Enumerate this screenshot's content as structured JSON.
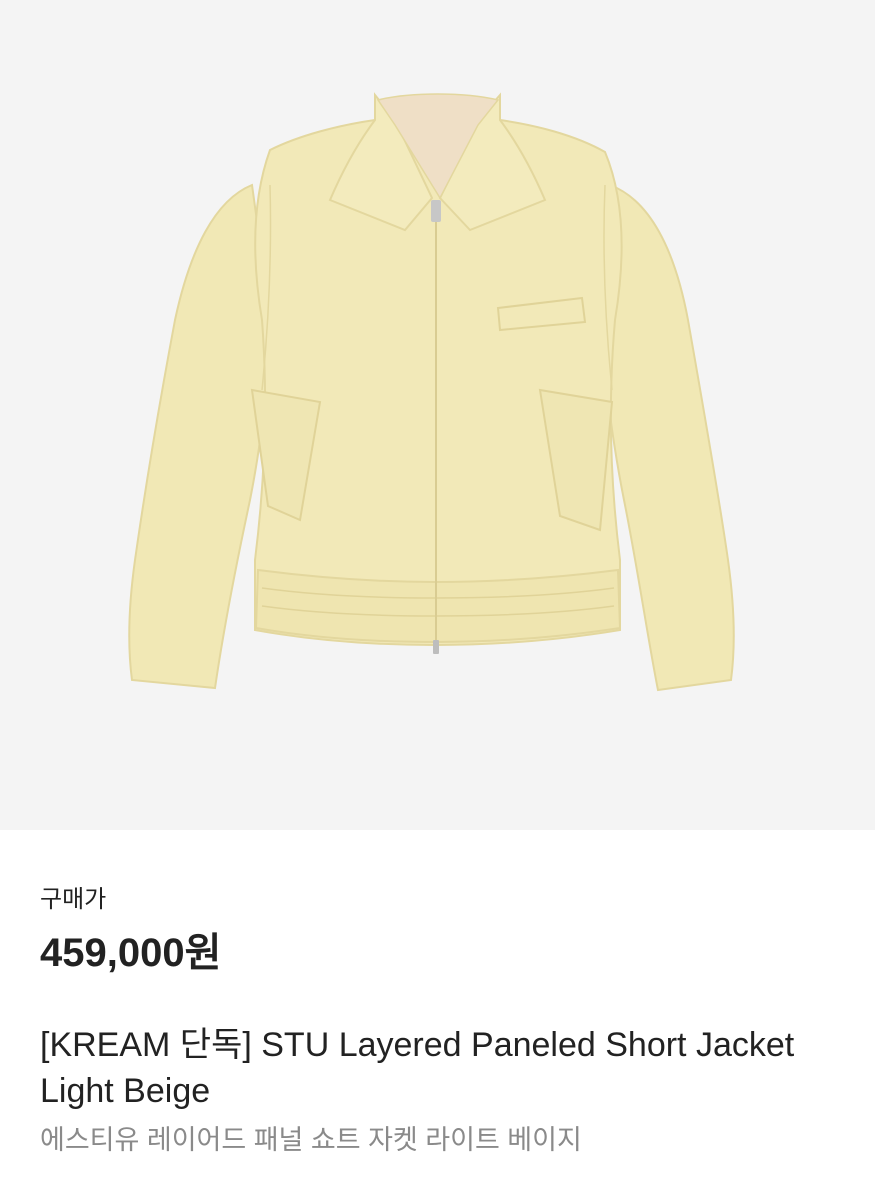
{
  "product": {
    "image_alt": "STU Layered Paneled Short Jacket Light Beige",
    "background_color": "#f4f4f4",
    "jacket_color": "#f2e9b8",
    "price_label": "구매가",
    "price": "459,000원",
    "name": "[KREAM 단독] STU Layered Paneled Short Jacket Light Beige",
    "name_ko": "에스티유 레이어드 패널 쇼트 자켓 라이트 베이지"
  }
}
